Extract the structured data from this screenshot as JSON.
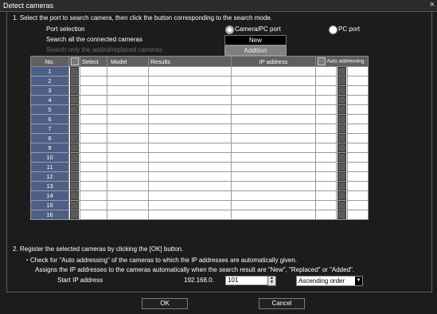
{
  "window": {
    "title": "Detect cameras",
    "close_label": "×"
  },
  "step1": {
    "text": "1. Select the port to search camera, then click the button corresponding to the search mode.",
    "port_label": "Port selection",
    "radio_camera": "Camera/PC port",
    "radio_pc": "PC port",
    "search_all_label": "Search all the connected cameras",
    "new_button": "New",
    "search_added_label": "Search only the  added/replaced cameras",
    "addition_button": "Addition"
  },
  "table": {
    "headers": {
      "no": "No.",
      "select": "Select",
      "model": "Model",
      "results": "Results",
      "ip": "IP address",
      "auto": "Auto addressing"
    },
    "rows": [
      "1",
      "2",
      "3",
      "4",
      "5",
      "6",
      "7",
      "8",
      "9",
      "10",
      "11",
      "12",
      "13",
      "14",
      "15",
      "16"
    ]
  },
  "step2": {
    "text": "2. Register the selected cameras by clicking the [OK] button.",
    "check_note": "・Check for \"Auto addressing\" of the cameras to which the IP addresses are automatically given.",
    "assign_note": "Assigns the IP addresses to the cameras automatically when the search result are \"New\", \"Replaced\" or \"Added\".",
    "start_ip_label": "Start IP address",
    "ip_prefix": "192.168.0.",
    "ip_value": "101",
    "order_value": "Ascending order"
  },
  "footer": {
    "ok": "OK",
    "cancel": "Cancel"
  }
}
